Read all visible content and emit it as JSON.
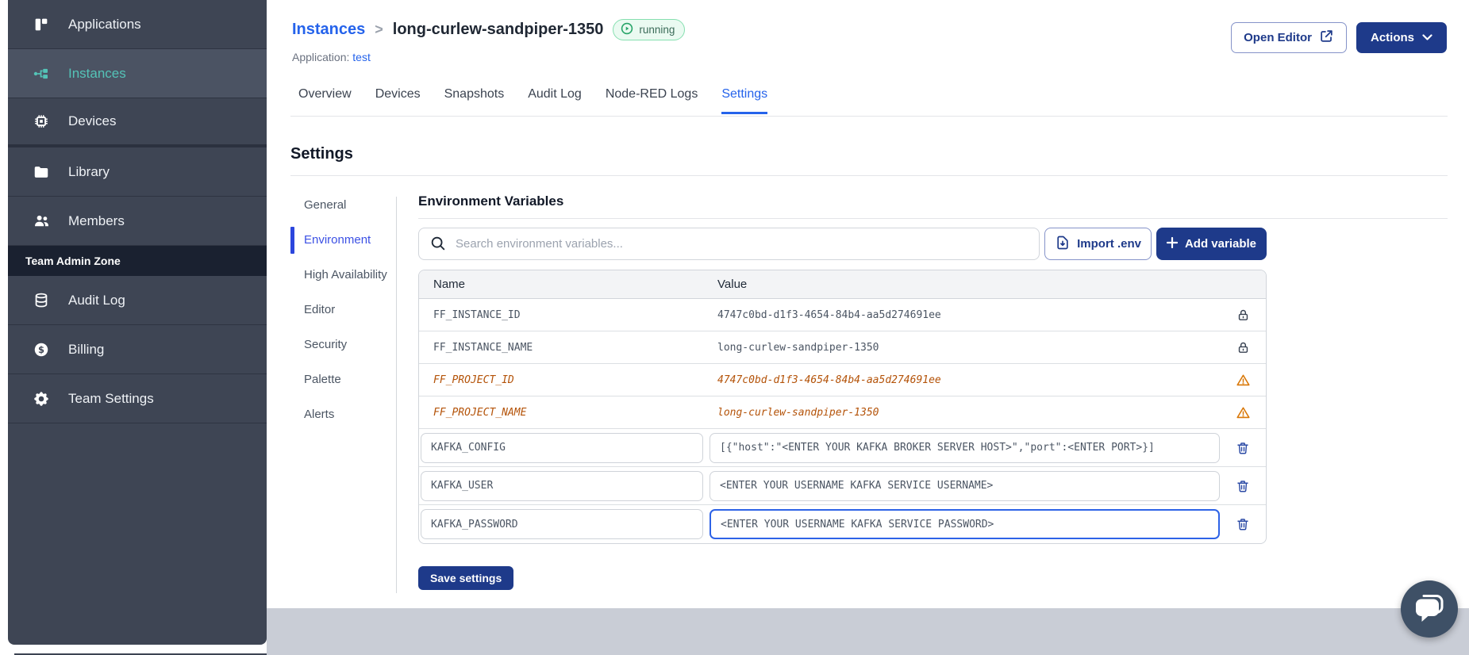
{
  "sidebar": {
    "main_items": [
      {
        "label": "Applications",
        "icon": "applications-icon",
        "active": false
      },
      {
        "label": "Instances",
        "icon": "instances-icon",
        "active": true
      },
      {
        "label": "Devices",
        "icon": "devices-icon",
        "active": false
      },
      {
        "label": "Library",
        "icon": "library-icon",
        "active": false
      },
      {
        "label": "Members",
        "icon": "members-icon",
        "active": false
      }
    ],
    "section_label": "Team Admin Zone",
    "admin_items": [
      {
        "label": "Audit Log",
        "icon": "audit-log-icon",
        "active": false
      },
      {
        "label": "Billing",
        "icon": "billing-icon",
        "active": false
      },
      {
        "label": "Team Settings",
        "icon": "team-settings-icon",
        "active": false
      }
    ]
  },
  "header": {
    "breadcrumb_root": "Instances",
    "breadcrumb_separator": ">",
    "instance_name": "long-curlew-sandpiper-1350",
    "status": "running",
    "application_label": "Application:",
    "application_name": "test",
    "open_editor_label": "Open Editor",
    "actions_label": "Actions"
  },
  "tabs": [
    {
      "label": "Overview",
      "active": false
    },
    {
      "label": "Devices",
      "active": false
    },
    {
      "label": "Snapshots",
      "active": false
    },
    {
      "label": "Audit Log",
      "active": false
    },
    {
      "label": "Node-RED Logs",
      "active": false
    },
    {
      "label": "Settings",
      "active": true
    }
  ],
  "settings": {
    "title": "Settings",
    "nav": [
      {
        "label": "General",
        "active": false
      },
      {
        "label": "Environment",
        "active": true
      },
      {
        "label": "High Availability",
        "active": false
      },
      {
        "label": "Editor",
        "active": false
      },
      {
        "label": "Security",
        "active": false
      },
      {
        "label": "Palette",
        "active": false
      },
      {
        "label": "Alerts",
        "active": false
      }
    ],
    "panel_title": "Environment Variables",
    "search_placeholder": "Search environment variables...",
    "import_label": "Import .env",
    "add_label": "Add variable",
    "save_label": "Save settings",
    "table": {
      "columns": [
        "Name",
        "Value"
      ],
      "rows": [
        {
          "name": "FF_INSTANCE_ID",
          "value": "4747c0bd-d1f3-4654-84b4-aa5d274691ee",
          "type": "locked"
        },
        {
          "name": "FF_INSTANCE_NAME",
          "value": "long-curlew-sandpiper-1350",
          "type": "locked"
        },
        {
          "name": "FF_PROJECT_ID",
          "value": "4747c0bd-d1f3-4654-84b4-aa5d274691ee",
          "type": "deprecated"
        },
        {
          "name": "FF_PROJECT_NAME",
          "value": "long-curlew-sandpiper-1350",
          "type": "deprecated"
        },
        {
          "name": "KAFKA_CONFIG",
          "value": "[{\"host\":\"<ENTER YOUR KAFKA BROKER SERVER HOST>\",\"port\":<ENTER PORT>}]",
          "type": "editable",
          "focused": false
        },
        {
          "name": "KAFKA_USER",
          "value": "<ENTER YOUR USERNAME KAFKA SERVICE USERNAME>",
          "type": "editable",
          "focused": false
        },
        {
          "name": "KAFKA_PASSWORD",
          "value": "<ENTER YOUR USERNAME KAFKA SERVICE PASSWORD>",
          "type": "editable",
          "focused": true
        }
      ]
    }
  },
  "colors": {
    "primary_navy": "#1e3a8a",
    "link_blue": "#2563eb",
    "sidebar_bg": "#3e4554",
    "sidebar_teal": "#54c3b7",
    "deprecated_orange": "#b45309",
    "status_green": "#27a468",
    "footer_gray": "#c9cdd6"
  }
}
